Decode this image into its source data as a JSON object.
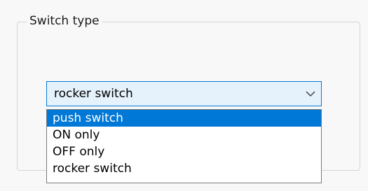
{
  "group": {
    "title": "Switch type"
  },
  "combo": {
    "value": "rocker switch"
  },
  "dropdown": {
    "options": [
      "push switch",
      "ON only",
      "OFF only",
      "rocker switch"
    ],
    "highlighted": "push switch"
  },
  "colors": {
    "accent": "#0078d7",
    "combo_bg": "#e5f1fb",
    "panel_bg": "#f8f8f8"
  },
  "icons": {
    "combo_arrow": "chevron-down-icon"
  }
}
